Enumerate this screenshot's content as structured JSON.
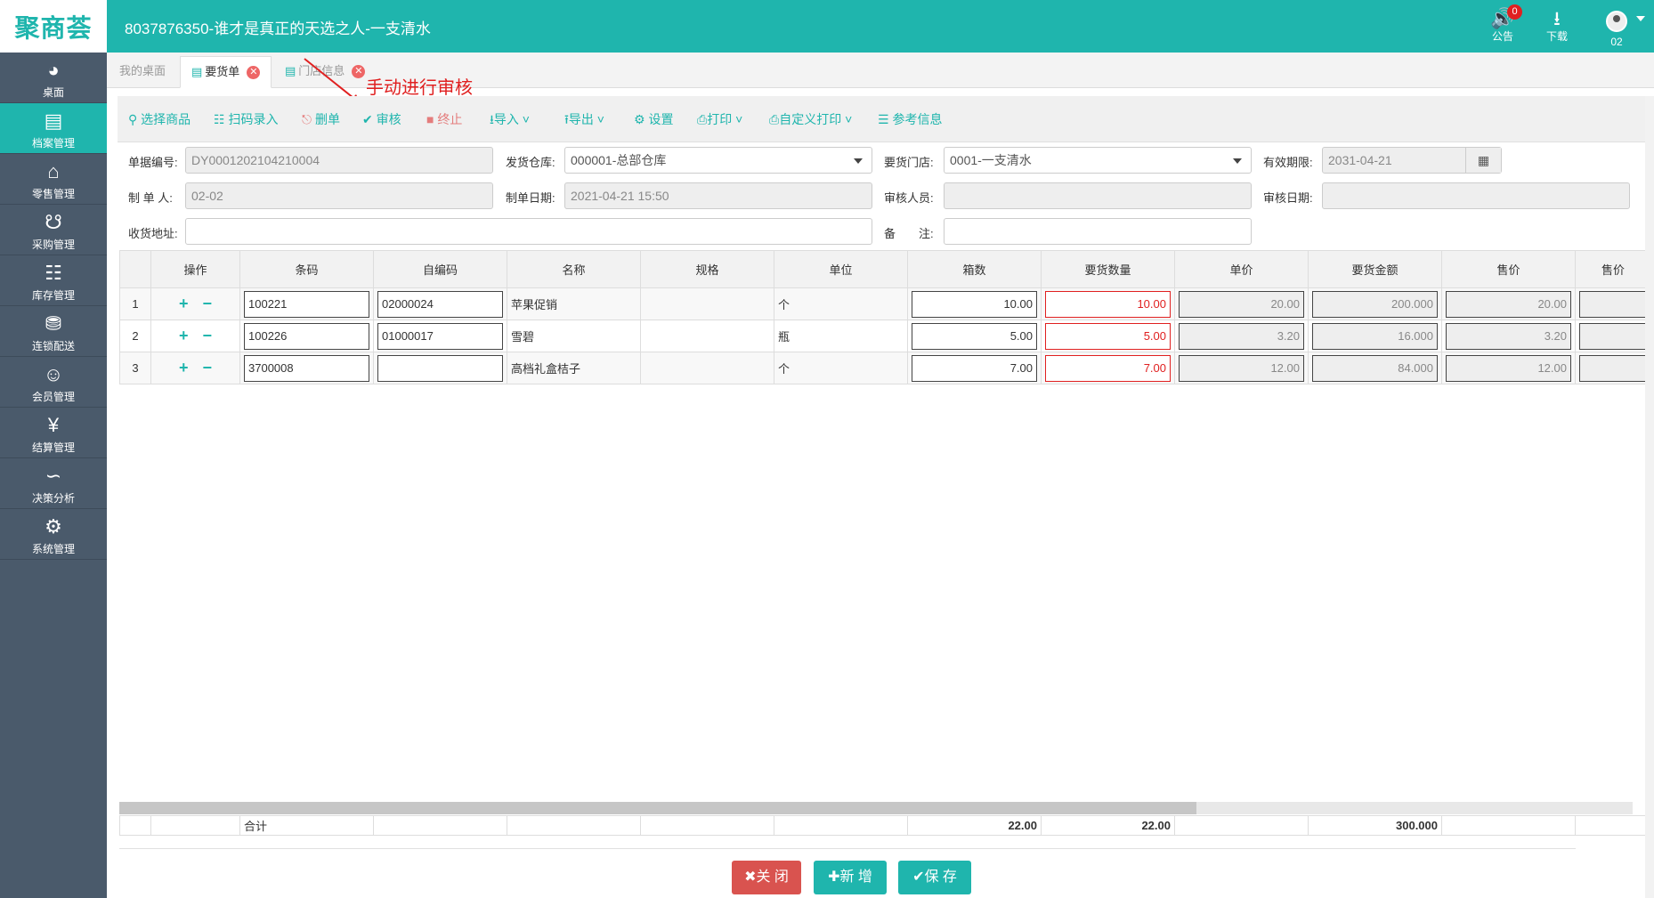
{
  "app": {
    "logo": "聚商荟",
    "title": "8037876350-谁才是真正的天选之人-一支清水"
  },
  "topbar": {
    "notice_label": "公告",
    "notice_count": "0",
    "download_label": "下载",
    "user_label": "02"
  },
  "sidebar": {
    "items": [
      {
        "label": "桌面",
        "icon": "dashboard-icon"
      },
      {
        "label": "档案管理",
        "icon": "archive-icon"
      },
      {
        "label": "零售管理",
        "icon": "store-icon"
      },
      {
        "label": "采购管理",
        "icon": "cart-icon"
      },
      {
        "label": "库存管理",
        "icon": "inventory-icon"
      },
      {
        "label": "连锁配送",
        "icon": "truck-icon"
      },
      {
        "label": "会员管理",
        "icon": "member-icon"
      },
      {
        "label": "结算管理",
        "icon": "settlement-icon"
      },
      {
        "label": "决策分析",
        "icon": "chart-icon"
      },
      {
        "label": "系统管理",
        "icon": "gear-icon"
      }
    ]
  },
  "tabs": [
    {
      "label": "我的桌面"
    },
    {
      "label": "要货单"
    },
    {
      "label": "门店信息"
    }
  ],
  "toolbar": {
    "select_goods": "选择商品",
    "scan_entry": "扫码录入",
    "delete": "删单",
    "audit": "审核",
    "terminate": "终止",
    "import": "导入",
    "export": "导出",
    "settings": "设置",
    "print": "打印",
    "custom_print": "自定义打印",
    "reference": "参考信息"
  },
  "annotation": "手动进行审核",
  "form": {
    "doc_no_label": "单据编号:",
    "doc_no": "DY0001202104210004",
    "warehouse_label": "发货仓库:",
    "warehouse": "000001-总部仓库",
    "store_label": "要货门店:",
    "store": "0001-一支清水",
    "valid_label": "有效期限:",
    "valid_date": "2031-04-21",
    "maker_label": "制 单 人:",
    "maker": "02-02",
    "make_date_label": "制单日期:",
    "make_date": "2021-04-21 15:50",
    "auditor_label": "审核人员:",
    "auditor": "",
    "audit_date_label": "审核日期:",
    "audit_date": "",
    "address_label": "收货地址:",
    "address": "",
    "remark_label": "备　　注:",
    "remark": ""
  },
  "grid": {
    "columns": [
      "",
      "操作",
      "条码",
      "自编码",
      "名称",
      "规格",
      "单位",
      "箱数",
      "要货数量",
      "单价",
      "要货金额",
      "售价",
      "售价"
    ],
    "rows": [
      {
        "no": "1",
        "barcode": "100221",
        "code": "02000024",
        "name": "苹果促销",
        "spec": "",
        "unit": "个",
        "boxes": "10.00",
        "qty": "10.00",
        "price": "20.00",
        "amount": "200.000",
        "sale": "20.00"
      },
      {
        "no": "2",
        "barcode": "100226",
        "code": "01000017",
        "name": "雪碧",
        "spec": "",
        "unit": "瓶",
        "boxes": "5.00",
        "qty": "5.00",
        "price": "3.20",
        "amount": "16.000",
        "sale": "3.20"
      },
      {
        "no": "3",
        "barcode": "3700008",
        "code": "",
        "name": "高档礼盒桔子",
        "spec": "",
        "unit": "个",
        "boxes": "7.00",
        "qty": "7.00",
        "price": "12.00",
        "amount": "84.000",
        "sale": "12.00"
      }
    ],
    "total_label": "合计",
    "total_boxes": "22.00",
    "total_qty": "22.00",
    "total_amount": "300.000"
  },
  "footer": {
    "close": "关 闭",
    "new": "新 增",
    "save": "保 存"
  }
}
